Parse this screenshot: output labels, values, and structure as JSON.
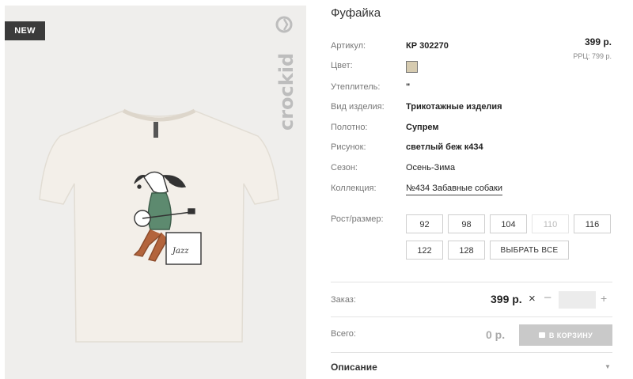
{
  "badge": "NEW",
  "brand": "crockid",
  "product": {
    "title": "Фуфайка"
  },
  "price": {
    "value": "399 р.",
    "rrp": "РРЦ: 799 р."
  },
  "attributes": {
    "article": {
      "label": "Артикул:",
      "value": "КР 302270"
    },
    "color": {
      "label": "Цвет:",
      "swatch": "#d6cbb0"
    },
    "insulation": {
      "label": "Утеплитель:",
      "value": "\""
    },
    "type": {
      "label": "Вид изделия:",
      "value": "Трикотажные изделия"
    },
    "fabric": {
      "label": "Полотно:",
      "value": "Супрем"
    },
    "pattern": {
      "label": "Рисунок:",
      "value": "светлый беж к434"
    },
    "season": {
      "label": "Сезон:",
      "value": "Осень-Зима"
    },
    "collection": {
      "label": "Коллекция:",
      "value": "№434 Забавные собаки"
    }
  },
  "sizes": {
    "label": "Рост/размер:",
    "items": [
      {
        "label": "92",
        "disabled": false
      },
      {
        "label": "98",
        "disabled": false
      },
      {
        "label": "104",
        "disabled": false
      },
      {
        "label": "110",
        "disabled": true
      },
      {
        "label": "116",
        "disabled": false
      },
      {
        "label": "122",
        "disabled": false
      },
      {
        "label": "128",
        "disabled": false
      }
    ],
    "select_all": "ВЫБРАТЬ ВСЕ"
  },
  "order": {
    "label": "Заказ:",
    "price": "399 р.",
    "times": "×",
    "minus": "–",
    "plus": "+",
    "quantity": ""
  },
  "total": {
    "label": "Всего:",
    "value": "0 р.",
    "cart_button": "В КОРЗИНУ"
  },
  "description": {
    "label": "Описание",
    "chevron": "▼"
  },
  "colors": {
    "badge_bg": "#3b3b3b",
    "cart_bg": "#c9c9c9",
    "photo_bg": "#efeeec",
    "shirt": "#f2eee8"
  },
  "icons": [
    "close-icon",
    "minus-icon",
    "plus-icon",
    "cart-icon",
    "chevron-down-icon"
  ]
}
